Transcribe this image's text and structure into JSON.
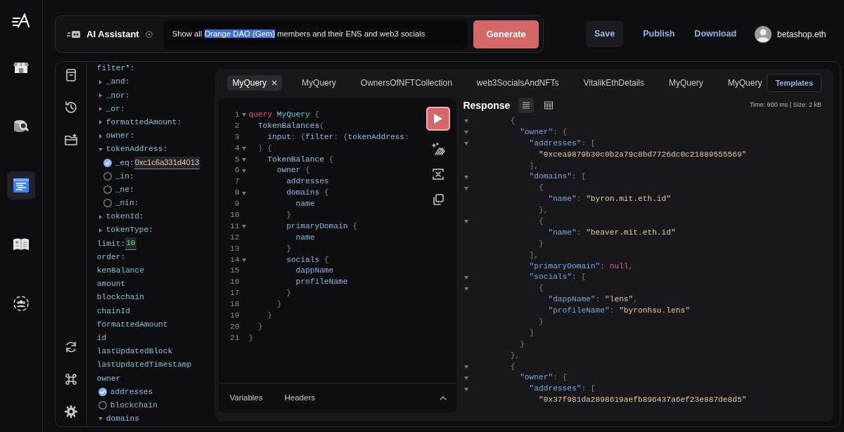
{
  "rail": [
    {
      "kind": "store",
      "selected": false
    },
    {
      "kind": "database-search",
      "selected": false
    },
    {
      "kind": "document",
      "selected": true
    },
    {
      "kind": "book",
      "selected": false
    },
    {
      "kind": "group",
      "selected": false
    }
  ],
  "assistant": {
    "title": "AI Assistant",
    "prompt": [
      {
        "text": "Show all ",
        "selected": false
      },
      {
        "text": "Orange DAO (Gem)",
        "selected": true
      },
      {
        "text": " members and their ENS and web3 socials",
        "selected": false
      }
    ],
    "button": "Generate"
  },
  "actions": [
    {
      "label": "Save",
      "kind": "filled"
    },
    {
      "label": "Publish",
      "kind": "link"
    },
    {
      "label": "Download",
      "kind": "link"
    }
  ],
  "user": {
    "name": "betashop.eth"
  },
  "explorer": [
    {
      "label": "filter*:",
      "kind": "plain",
      "children": [
        {
          "label": "_and:",
          "kind": "arrow",
          "expanded": false
        },
        {
          "label": "_nor:",
          "kind": "arrow",
          "expanded": false
        },
        {
          "label": "_or:",
          "kind": "arrow",
          "expanded": false
        },
        {
          "label": "formattedAmount:",
          "kind": "arrow",
          "expanded": false
        },
        {
          "label": "owner:",
          "kind": "arrow",
          "expanded": false
        },
        {
          "label": "tokenAddress:",
          "kind": "arrow",
          "expanded": true,
          "children": [
            {
              "label": "_eq:",
              "kind": "radio",
              "checked": true,
              "value": "0xc1c6a331d4013"
            },
            {
              "label": "_in:",
              "kind": "radio",
              "checked": false
            },
            {
              "label": "_ne:",
              "kind": "radio",
              "checked": false
            },
            {
              "label": "_nin:",
              "kind": "radio",
              "checked": false
            }
          ]
        },
        {
          "label": "tokenId:",
          "kind": "arrow",
          "expanded": false
        },
        {
          "label": "tokenType:",
          "kind": "arrow",
          "expanded": false
        }
      ]
    },
    {
      "label": "limit:",
      "kind": "plain",
      "value": "10"
    },
    {
      "label": "order:",
      "kind": "plain"
    },
    {
      "label": "kenBalance",
      "kind": "plain"
    },
    {
      "label": "amount",
      "kind": "plain"
    },
    {
      "label": "blockchain",
      "kind": "plain"
    },
    {
      "label": "chainId",
      "kind": "plain"
    },
    {
      "label": "formattedAmount",
      "kind": "plain"
    },
    {
      "label": "id",
      "kind": "plain"
    },
    {
      "label": "lastUpdatedBlock",
      "kind": "plain"
    },
    {
      "label": "lastUpdatedTimestamp",
      "kind": "plain"
    },
    {
      "label": "owner",
      "kind": "plain",
      "children": [
        {
          "label": "addresses",
          "kind": "radio",
          "checked": true
        },
        {
          "label": "blockchain",
          "kind": "radio",
          "checked": false
        },
        {
          "label": "domains",
          "kind": "arrow",
          "expanded": true
        }
      ]
    }
  ],
  "tabs": [
    {
      "label": "MyQuery",
      "selected": true
    },
    {
      "label": "MyQuery",
      "selected": false
    },
    {
      "label": "OwnersOfNFTCollection",
      "selected": false
    },
    {
      "label": "web3SocialsAndNFTs",
      "selected": false
    },
    {
      "label": "VitalikEthDetails",
      "selected": false
    },
    {
      "label": "MyQuery",
      "selected": false
    },
    {
      "label": "MyQuery",
      "selected": false
    }
  ],
  "templates_button": "Templates",
  "editor": {
    "lines": [
      {
        "n": "1",
        "fold": true,
        "tokens": [
          {
            "kind": "kw",
            "text": "query"
          },
          {
            "kind": "name",
            "text": " MyQuery"
          },
          {
            "kind": "punct",
            "text": " {"
          }
        ]
      },
      {
        "n": "2",
        "fold": false,
        "tokens": [
          {
            "kind": "type",
            "text": "  TokenBalances"
          },
          {
            "kind": "punct",
            "text": "("
          }
        ]
      },
      {
        "n": "3",
        "fold": false,
        "tokens": [
          {
            "kind": "field",
            "text": "    input"
          },
          {
            "kind": "punct",
            "text": ": {"
          },
          {
            "kind": "field",
            "text": "filter"
          },
          {
            "kind": "punct",
            "text": ": {"
          },
          {
            "kind": "field",
            "text": "tokenAddress"
          },
          {
            "kind": "punct",
            "text": ":"
          }
        ]
      },
      {
        "n": "4",
        "fold": true,
        "tokens": [
          {
            "kind": "punct",
            "text": "  ) {"
          }
        ]
      },
      {
        "n": "5",
        "fold": true,
        "tokens": [
          {
            "kind": "type",
            "text": "    TokenBalance"
          },
          {
            "kind": "punct",
            "text": " {"
          }
        ]
      },
      {
        "n": "6",
        "fold": true,
        "tokens": [
          {
            "kind": "field",
            "text": "      owner"
          },
          {
            "kind": "punct",
            "text": " {"
          }
        ]
      },
      {
        "n": "7",
        "fold": false,
        "tokens": [
          {
            "kind": "field",
            "text": "        addresses"
          }
        ]
      },
      {
        "n": "8",
        "fold": true,
        "tokens": [
          {
            "kind": "field",
            "text": "        domains"
          },
          {
            "kind": "punct",
            "text": " {"
          }
        ]
      },
      {
        "n": "9",
        "fold": false,
        "tokens": [
          {
            "kind": "field",
            "text": "          name"
          }
        ]
      },
      {
        "n": "10",
        "fold": false,
        "tokens": [
          {
            "kind": "punct",
            "text": "        }"
          }
        ]
      },
      {
        "n": "11",
        "fold": true,
        "tokens": [
          {
            "kind": "field",
            "text": "        primaryDomain"
          },
          {
            "kind": "punct",
            "text": " {"
          }
        ]
      },
      {
        "n": "12",
        "fold": false,
        "tokens": [
          {
            "kind": "field",
            "text": "          name"
          }
        ]
      },
      {
        "n": "13",
        "fold": false,
        "tokens": [
          {
            "kind": "punct",
            "text": "        }"
          }
        ]
      },
      {
        "n": "14",
        "fold": true,
        "tokens": [
          {
            "kind": "field",
            "text": "        socials"
          },
          {
            "kind": "punct",
            "text": " {"
          }
        ]
      },
      {
        "n": "15",
        "fold": false,
        "tokens": [
          {
            "kind": "field",
            "text": "          dappName"
          }
        ]
      },
      {
        "n": "16",
        "fold": false,
        "tokens": [
          {
            "kind": "field",
            "text": "          profileName"
          }
        ]
      },
      {
        "n": "17",
        "fold": false,
        "tokens": [
          {
            "kind": "punct",
            "text": "        }"
          }
        ]
      },
      {
        "n": "18",
        "fold": false,
        "tokens": [
          {
            "kind": "punct",
            "text": "      }"
          }
        ]
      },
      {
        "n": "19",
        "fold": false,
        "tokens": [
          {
            "kind": "punct",
            "text": "    }"
          }
        ]
      },
      {
        "n": "20",
        "fold": false,
        "tokens": [
          {
            "kind": "punct",
            "text": "  }"
          }
        ]
      },
      {
        "n": "21",
        "fold": false,
        "tokens": [
          {
            "kind": "punct",
            "text": "}"
          }
        ]
      }
    ],
    "bottom_tabs": [
      "Variables",
      "Headers"
    ]
  },
  "response": {
    "title": "Response",
    "views": [
      {
        "kind": "list",
        "selected": true
      },
      {
        "kind": "table",
        "selected": false
      }
    ],
    "stats": "Time: 900 ms | Size: 2 kB",
    "lines": [
      {
        "fold": true,
        "tokens": [
          {
            "kind": "punct",
            "text": "      {"
          }
        ]
      },
      {
        "fold": true,
        "tokens": [
          {
            "kind": "key",
            "text": "        \"owner\""
          },
          {
            "kind": "punct",
            "text": ": {"
          }
        ]
      },
      {
        "fold": true,
        "tokens": [
          {
            "kind": "key",
            "text": "          \"addresses\""
          },
          {
            "kind": "punct",
            "text": ": ["
          }
        ]
      },
      {
        "fold": false,
        "tokens": [
          {
            "kind": "str",
            "text": "            \"0xcea9879b30c0b2a79c8bd7726dc0c21889555569\""
          }
        ]
      },
      {
        "fold": false,
        "tokens": [
          {
            "kind": "punct",
            "text": "          ],"
          }
        ]
      },
      {
        "fold": true,
        "tokens": [
          {
            "kind": "key",
            "text": "          \"domains\""
          },
          {
            "kind": "punct",
            "text": ": ["
          }
        ]
      },
      {
        "fold": true,
        "tokens": [
          {
            "kind": "punct",
            "text": "            {"
          }
        ]
      },
      {
        "fold": false,
        "tokens": [
          {
            "kind": "key",
            "text": "              \"name\""
          },
          {
            "kind": "punct",
            "text": ": "
          },
          {
            "kind": "str",
            "text": "\"byron.mit.eth.id\""
          }
        ]
      },
      {
        "fold": false,
        "tokens": [
          {
            "kind": "punct",
            "text": "            },"
          }
        ]
      },
      {
        "fold": true,
        "tokens": [
          {
            "kind": "punct",
            "text": "            {"
          }
        ]
      },
      {
        "fold": false,
        "tokens": [
          {
            "kind": "key",
            "text": "              \"name\""
          },
          {
            "kind": "punct",
            "text": ": "
          },
          {
            "kind": "str",
            "text": "\"beaver.mit.eth.id\""
          }
        ]
      },
      {
        "fold": false,
        "tokens": [
          {
            "kind": "punct",
            "text": "            }"
          }
        ]
      },
      {
        "fold": false,
        "tokens": [
          {
            "kind": "punct",
            "text": "          ],"
          }
        ]
      },
      {
        "fold": false,
        "tokens": [
          {
            "kind": "key",
            "text": "          \"primaryDomain\""
          },
          {
            "kind": "punct",
            "text": ": "
          },
          {
            "kind": "null",
            "text": "null"
          },
          {
            "kind": "punct",
            "text": ","
          }
        ]
      },
      {
        "fold": true,
        "tokens": [
          {
            "kind": "key",
            "text": "          \"socials\""
          },
          {
            "kind": "punct",
            "text": ": ["
          }
        ]
      },
      {
        "fold": true,
        "tokens": [
          {
            "kind": "punct",
            "text": "            {"
          }
        ]
      },
      {
        "fold": false,
        "tokens": [
          {
            "kind": "key",
            "text": "              \"dappName\""
          },
          {
            "kind": "punct",
            "text": ": "
          },
          {
            "kind": "str",
            "text": "\"lens\""
          },
          {
            "kind": "punct",
            "text": ","
          }
        ]
      },
      {
        "fold": false,
        "tokens": [
          {
            "kind": "key",
            "text": "              \"profileName\""
          },
          {
            "kind": "punct",
            "text": ": "
          },
          {
            "kind": "str",
            "text": "\"byronhsu.lens\""
          }
        ]
      },
      {
        "fold": false,
        "tokens": [
          {
            "kind": "punct",
            "text": "            }"
          }
        ]
      },
      {
        "fold": false,
        "tokens": [
          {
            "kind": "punct",
            "text": "          ]"
          }
        ]
      },
      {
        "fold": false,
        "tokens": [
          {
            "kind": "punct",
            "text": "        }"
          }
        ]
      },
      {
        "fold": false,
        "tokens": [
          {
            "kind": "punct",
            "text": "      },"
          }
        ]
      },
      {
        "fold": true,
        "tokens": [
          {
            "kind": "punct",
            "text": "      {"
          }
        ]
      },
      {
        "fold": true,
        "tokens": [
          {
            "kind": "key",
            "text": "        \"owner\""
          },
          {
            "kind": "punct",
            "text": ": {"
          }
        ]
      },
      {
        "fold": true,
        "tokens": [
          {
            "kind": "key",
            "text": "          \"addresses\""
          },
          {
            "kind": "punct",
            "text": ": ["
          }
        ]
      },
      {
        "fold": false,
        "tokens": [
          {
            "kind": "str",
            "text": "            \"0x37f981da2898619aefb896437a6ef23e887de8d5\""
          }
        ]
      }
    ]
  }
}
